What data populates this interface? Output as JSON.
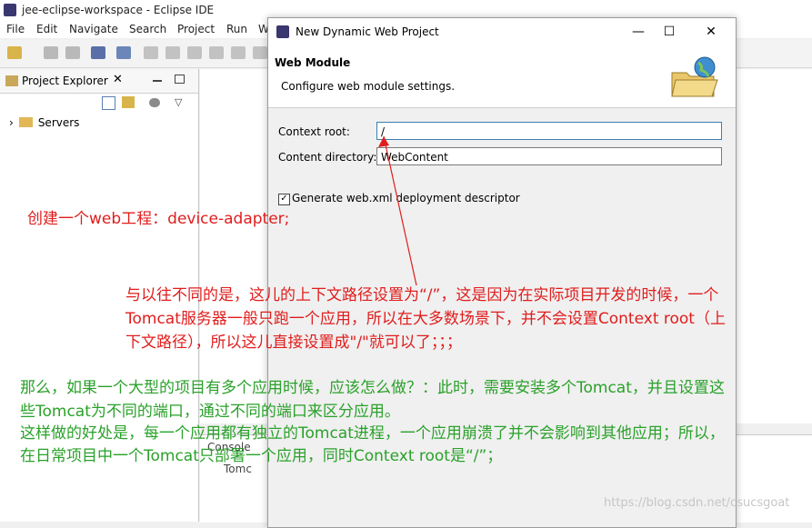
{
  "window": {
    "title": "jee-eclipse-workspace - Eclipse IDE"
  },
  "menu": [
    "File",
    "Edit",
    "Navigate",
    "Search",
    "Project",
    "Run",
    "W"
  ],
  "explorer": {
    "tab_label": "Project Explorer",
    "close_glyph": "✕",
    "tree": [
      {
        "label": "Servers",
        "expand_glyph": "›"
      }
    ]
  },
  "console": {
    "label": "Console",
    "item": "Tomc"
  },
  "dialog": {
    "title": "New Dynamic Web Project",
    "banner_title": "Web Module",
    "banner_subtitle": "Configure web module settings.",
    "context_root_label": "Context root:",
    "context_root_value": "/",
    "content_dir_label": "Content directory:",
    "content_dir_value": "WebContent",
    "checkbox_label": "Generate web.xml deployment descriptor",
    "checkbox_checked": true,
    "window_buttons": {
      "minimize": "—",
      "maximize": "☐",
      "close": "✕"
    }
  },
  "annotations": {
    "red_1": "创建一个web工程：device-adapter;",
    "red_2": [
      "与以往不同的是，这儿的上下文路径设置为“/”，这是因为在实际项目开发的时候，一个",
      "Tomcat服务器一般只跑一个应用，所以在大多数场景下，并不会设置Context root（上",
      "下文路径），所以这儿直接设置成\"/\"就可以了；；；"
    ],
    "green": [
      "那么，如果一个大型的项目有多个应用时候，应该怎么做？：此时，需要安装多个Tomcat，并且设置这",
      "些Tomcat为不同的端口，通过不同的端口来区分应用。",
      "这样做的好处是，每一个应用都有独立的Tomcat进程，一个应用崩溃了并不会影响到其他应用；所以，",
      "在日常项目中一个Tomcat只部署一个应用，同时Context root是“/”；"
    ]
  },
  "watermark": "https://blog.csdn.net/csucsgoat",
  "colors": {
    "annotation_red": "#e01d1d",
    "annotation_green": "#2aa12a",
    "focus_border": "#3c7fb1"
  }
}
